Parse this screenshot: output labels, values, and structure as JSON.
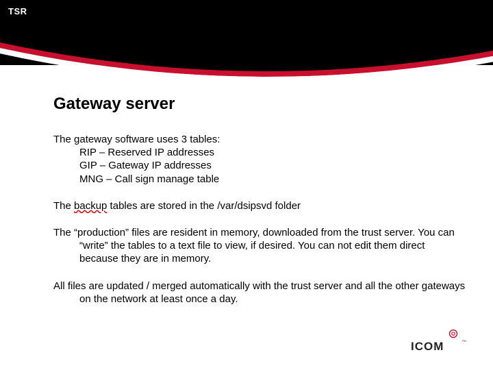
{
  "brand": "TSR",
  "title": "Gateway server",
  "intro": "The gateway software uses 3 tables:",
  "tables": {
    "t0": "RIP – Reserved IP addresses",
    "t1": "GIP – Gateway IP addresses",
    "t2": "MNG – Call sign manage table"
  },
  "backup_line": {
    "pre": "The ",
    "word": "backup",
    "post": " tables are stored in the /var/dsipsvd folder"
  },
  "production_para": "The “production” files are resident in memory, downloaded from the trust server. You can “write” the tables to a text file to view, if desired. You can not edit them direct because they are in memory.",
  "update_para": "All files are updated / merged automatically with the trust server and all the other gateways on the network at least once a day.",
  "logo_text": "ICOM"
}
